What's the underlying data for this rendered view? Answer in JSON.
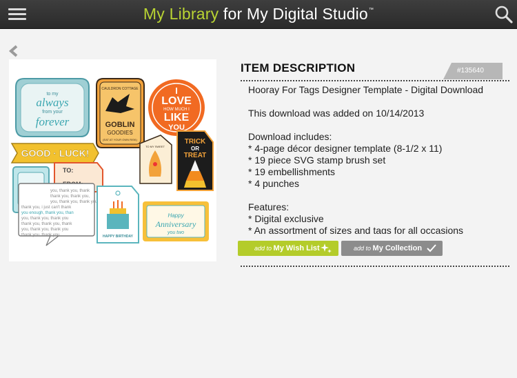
{
  "header": {
    "title_accent": "My Library",
    "title_rest": " for My Digital Studio",
    "trademark": "™"
  },
  "item": {
    "section_title": "ITEM DESCRIPTION",
    "item_number": "#135640",
    "description_lines": [
      "Hooray For Tags Designer Template - Digital Download",
      "",
      "This download was added on 10/14/2013",
      "",
      "Download includes:",
      "* 4-page décor designer template (8-1/2 x 11)",
      "* 19 piece SVG stamp brush set",
      "* 19 embellishments",
      "* 4 punches",
      "",
      "Features:",
      "* Digital exclusive",
      "* An assortment of sizes and tags for all occasions"
    ]
  },
  "artwork": {
    "to_my": "to my",
    "always": "always",
    "from_your": "from your",
    "forever": "forever",
    "cauldron": "CAULDRON COTTAGE",
    "goblin": "GOBLIN",
    "goodies": "GOODIES",
    "eat_at": "(EAT AT YOUR OWN RISK)",
    "i_love_1": "I",
    "i_love_2": "LOVE",
    "i_love_3": "HOW MUCH I",
    "i_love_4": "LIKE",
    "i_love_5": "YOU",
    "good_luck": "GOOD · LUCK!",
    "to": "TO:",
    "from": "FROM:",
    "sweet": "TO MY SWEET",
    "trick": "TRICK",
    "or": "OR",
    "treat": "TREAT",
    "miss_you_1": "miss",
    "miss_you_2": "you",
    "thank_you_1": "you, thank you, thank",
    "thank_you_2": "thank you, thank you,",
    "thank_you_3": "you, thank you, thank you",
    "thank_you_4": "thank you, i just can't thank",
    "thank_you_5": "you enough, thank you, than",
    "thank_you_6": "you, thank you, thank you",
    "thank_you_7": "thank you, thank you, thank",
    "thank_you_8": "you, thank you, thank you",
    "thank_you_9": "thank you, thank you",
    "birthday": "HAPPY BIRTHDAY",
    "happy": "Happy",
    "anniversary": "Anniversary",
    "you_two": "you two"
  },
  "actions": {
    "wish_prefix": "add to ",
    "wish_label": "My Wish List",
    "collection_prefix": "add to ",
    "collection_label": "My Collection"
  },
  "colors": {
    "accent_green": "#b4cc2a",
    "topbar": "#333333",
    "collection_gray": "#8c8c8c",
    "tag_gray": "#b7b7b7"
  },
  "icons": {
    "menu": "hamburger-icon",
    "search": "search-icon",
    "back": "chevron-left-icon",
    "wish": "sparkle-icon",
    "collection": "checkmark-icon"
  }
}
